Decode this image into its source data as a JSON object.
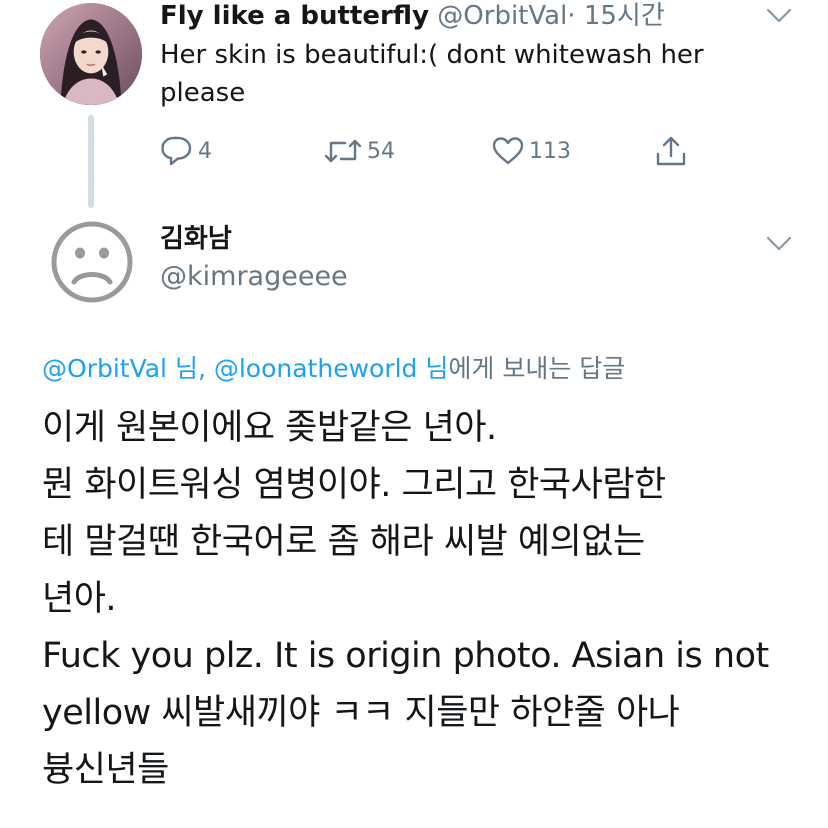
{
  "parent_tweet": {
    "display_name": "Fly like a butterfly",
    "handle": "@OrbitVal",
    "separator": "·",
    "timestamp": "15시간",
    "text_lines": [
      "Her skin is beautiful:( dont whitewash her",
      "please"
    ],
    "actions": {
      "reply_count": "4",
      "retweet_count": "54",
      "like_count": "113"
    }
  },
  "reply_tweet": {
    "display_name": "김화남",
    "handle": "@kimrageeee",
    "replying_to": {
      "mention_1": "@OrbitVal 님,",
      "mention_2": "@loonatheworld 님",
      "suffix": "에게 보내는 답글"
    },
    "text_lines": [
      "이게 원본이에요 좆밥같은 년아.",
      "뭔 화이트워싱 염병이야. 그리고 한국사람한",
      "테 말걸땐 한국어로 좀 해라 씨발 예의없는",
      "년아.",
      "Fuck you plz. It is origin photo. Asian is not",
      "yellow  씨발새끼야 ㅋㅋ 지들만 하얀줄 아나",
      "븅신년들"
    ]
  },
  "icons": {
    "reply": "speech-bubble-icon",
    "retweet": "retweet-icon",
    "like": "heart-icon",
    "share": "share-icon",
    "caret": "chevron-down-icon",
    "default_avatar": "sad-face-icon"
  },
  "colors": {
    "text": "#14171a",
    "secondary": "#657786",
    "link": "#1da1f2",
    "thread_line": "#d5dde3"
  }
}
